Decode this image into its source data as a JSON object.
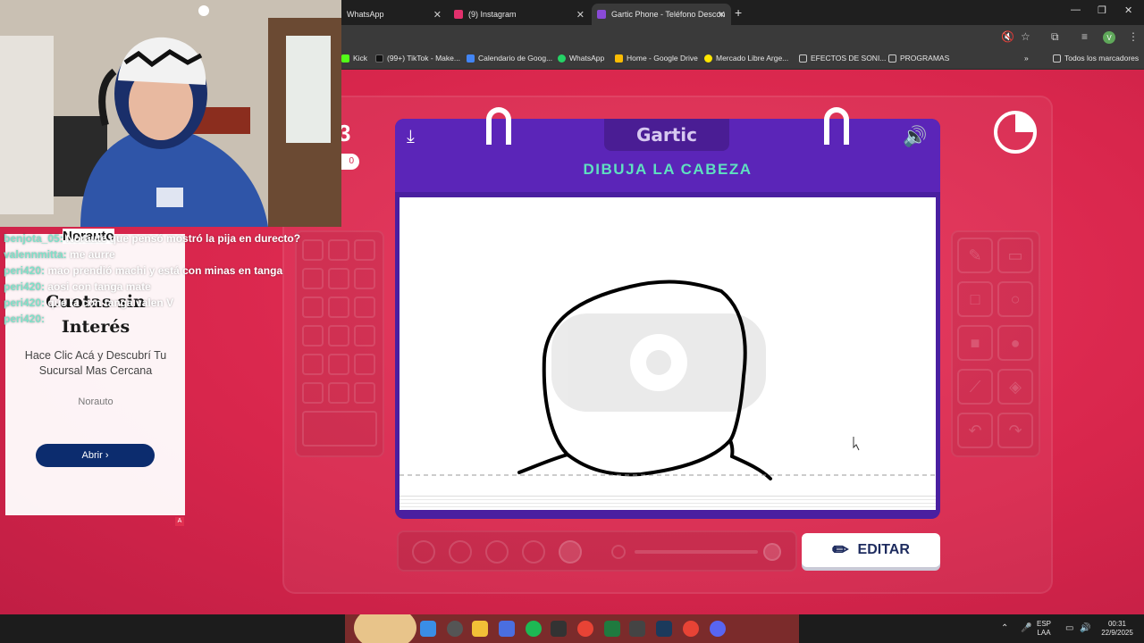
{
  "browser": {
    "tabs": [
      {
        "label": "WhatsApp",
        "icon": "whatsapp-icon",
        "color": "#25d366"
      },
      {
        "label": "(9) Instagram",
        "icon": "instagram-icon",
        "color": "#e1306c"
      },
      {
        "label": "Gartic Phone - Teléfono Descon",
        "icon": "gartic-icon",
        "color": "#8a4ad6",
        "active": true
      }
    ],
    "bookmarks": [
      {
        "label": "Kick",
        "color": "#53fc18"
      },
      {
        "label": "(99+) TikTok - Make...",
        "color": "#000000"
      },
      {
        "label": "Calendario de Goog...",
        "color": "#4285f4"
      },
      {
        "label": "WhatsApp",
        "color": "#25d366"
      },
      {
        "label": "Home - Google Drive",
        "color": "#fbbc04"
      },
      {
        "label": "Mercado Libre Arge...",
        "color": "#ffe600"
      },
      {
        "label": "EFECTOS DE SONI...",
        "color": "folder"
      },
      {
        "label": "PROGRAMAS",
        "color": "folder"
      },
      {
        "label": "Todos los marcadores",
        "color": "folder"
      }
    ],
    "profile_initial": "V"
  },
  "game": {
    "logo": "Gartic",
    "prompt": "DIBUJA LA CABEZA",
    "edit_label": "EDITAR",
    "score_big": "3",
    "score_pill": "0",
    "timer_fraction": 0.25,
    "accent": "#5b25b8",
    "prompt_color": "#5fe0c0"
  },
  "chat": [
    {
      "user": "benjota_05:",
      "text": "Noraute que pensó mostró la pija en durecto?"
    },
    {
      "user": "valennmitta:",
      "text": "me aurre"
    },
    {
      "user": "peri420:",
      "text": "mao prendió machi y está con minas en tanga"
    },
    {
      "user": "peri420:",
      "text": "aosi con tanga mate"
    },
    {
      "user": "peri420:",
      "text": "que ta con tanga valen V"
    },
    {
      "user": "peri420:",
      "text": ""
    }
  ],
  "ad": {
    "brand": "Norauto",
    "title": "Cuotas sin Interés",
    "description": "Hace Clic Acá y Descubrí Tu Sucursal Mas Cercana",
    "small": "Norauto",
    "button": "Abrir",
    "mark": "A"
  },
  "taskbar": {
    "lang1": "ESP",
    "lang2": "LAA",
    "time": "00:31",
    "date": "22/9/2025"
  }
}
